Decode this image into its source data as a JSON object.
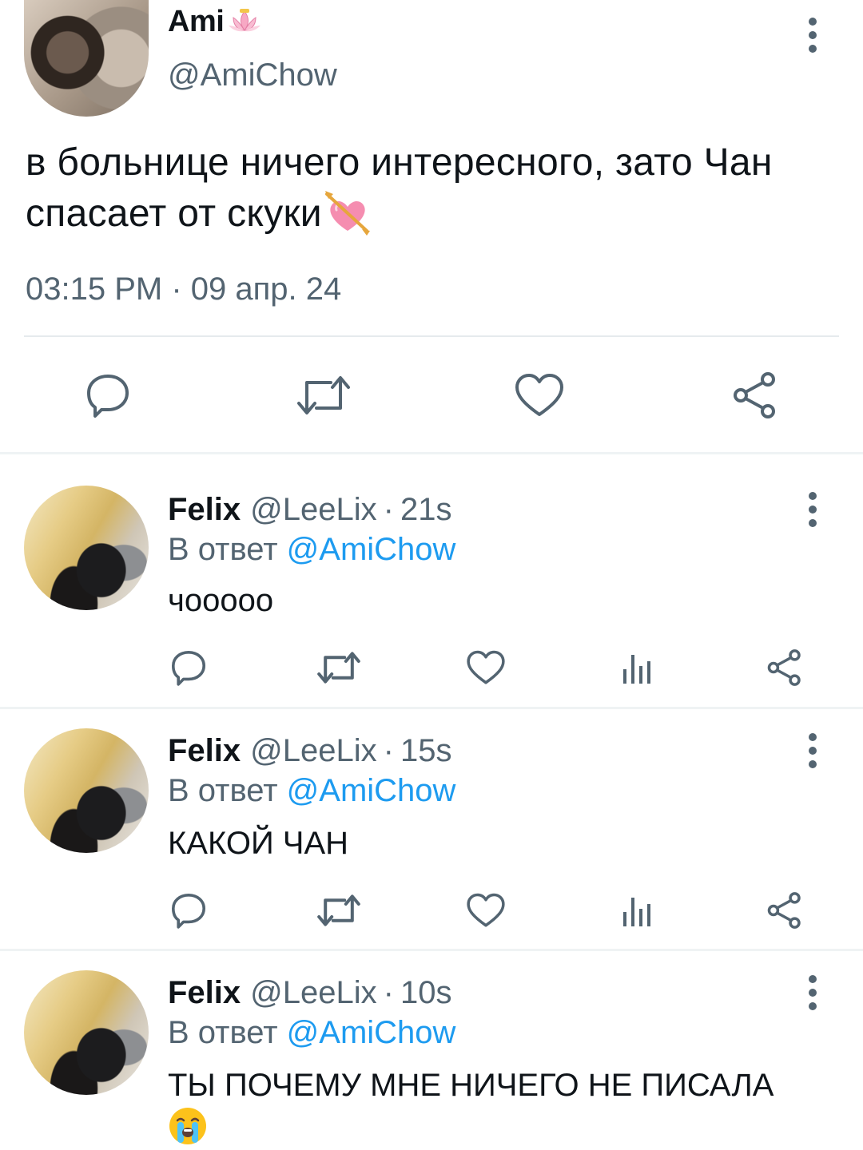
{
  "main_tweet": {
    "author_name": "Ami",
    "author_handle": "@AmiChow",
    "text": "в больнице ничего интересного, зато Чан спасает от скуки",
    "timestamp": "03:15 PM · 09 апр. 24",
    "name_emoji": "lotus-icon",
    "text_emoji": "heart-with-arrow-icon"
  },
  "replies": [
    {
      "author_name": "Felix",
      "author_handle": "@LeeLix",
      "separator": "·",
      "time": "21s",
      "reply_prefix": "В ответ",
      "reply_to": "@AmiChow",
      "text": "чооооо"
    },
    {
      "author_name": "Felix",
      "author_handle": "@LeeLix",
      "separator": "·",
      "time": "15s",
      "reply_prefix": "В ответ",
      "reply_to": "@AmiChow",
      "text": "КАКОЙ ЧАН"
    },
    {
      "author_name": "Felix",
      "author_handle": "@LeeLix",
      "separator": "·",
      "time": "10s",
      "reply_prefix": "В ответ",
      "reply_to": "@AmiChow",
      "text": "ТЫ ПОЧЕМУ МНЕ НИЧЕГО НЕ ПИСАЛА",
      "text_emoji": "loudly-crying-face-icon"
    }
  ],
  "colors": {
    "text": "#0f1419",
    "secondary": "#536471",
    "link": "#1d9bf0",
    "divider": "#eff3f4"
  }
}
